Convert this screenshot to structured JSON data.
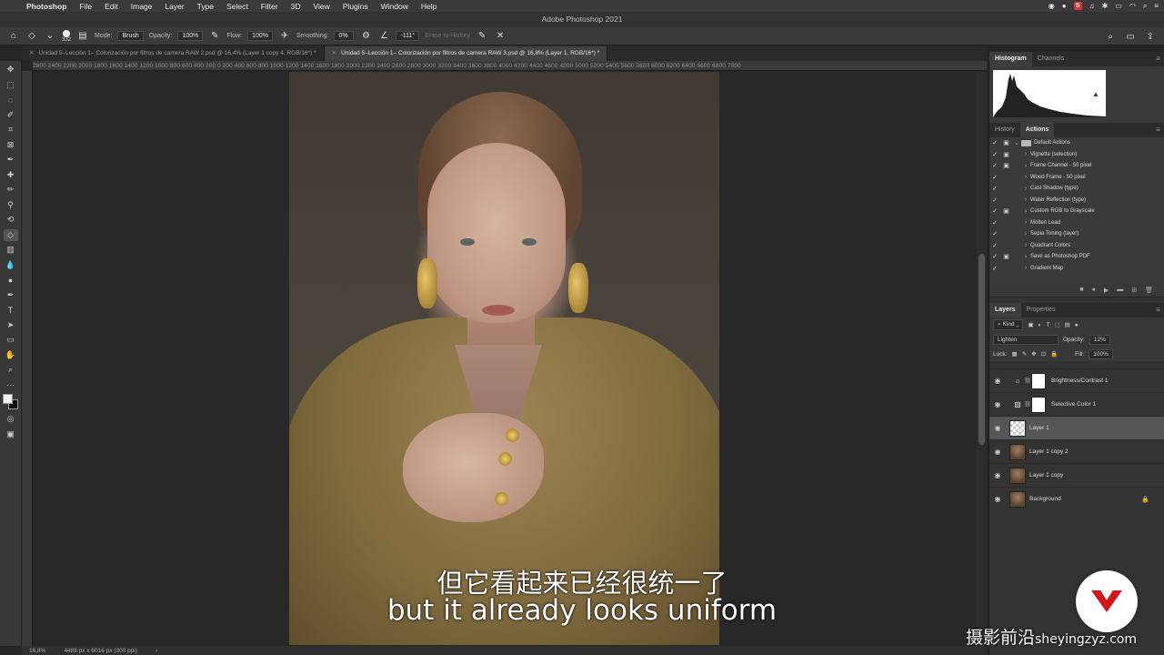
{
  "menubar": {
    "app": "Photoshop",
    "items": [
      "File",
      "Edit",
      "Image",
      "Layer",
      "Type",
      "Select",
      "Filter",
      "3D",
      "View",
      "Plugins",
      "Window",
      "Help"
    ],
    "badge": "S"
  },
  "window": {
    "title": "Adobe Photoshop 2021"
  },
  "options": {
    "brush_size": "332",
    "mode_label": "Mode:",
    "mode_value": "Brush",
    "opacity_label": "Opacity:",
    "opacity_value": "100%",
    "flow_label": "Flow:",
    "flow_value": "100%",
    "smoothing_label": "Smoothing:",
    "smoothing_value": "0%",
    "angle_value": "-111°",
    "erase_history_label": "Erase to History"
  },
  "tabs": [
    "Unidad 5–Lección 1– Colorización por filtros de camera RAW 2.psd @ 16,4% (Layer 1 copy 4, RGB/16*) *",
    "Unidad 5–Lección 1– Colorización por filtros de camera RAW 3.psd @ 16,8% (Layer 1, RGB/16*) *"
  ],
  "ruler": {
    "ticks": "2600 2400 2200 2000 1800 1600 1400 1200 1000 800 600 400 200 0 200 400 600 800 1000 1200 1400 1600 1800 2000 2200 2400 2600 2800 3000 3200 3400 3600 3800 4000 4200 4400 4600 4800 5000 5200 5400 5600 5800 6000 6200 6400 6600 6800 7000"
  },
  "subtitle": {
    "zh": "但它看起来已经很统一了",
    "en": "but it already looks uniform"
  },
  "status": {
    "zoom": "16,8%",
    "doc_size": "4488 px x 6016 px (300 ppi)",
    "arrow": "›"
  },
  "panels": {
    "top_tabs": [
      "Histogram",
      "Channels"
    ],
    "mid_tabs": [
      "History",
      "Actions"
    ],
    "actions": [
      {
        "label": "Default Actions",
        "folder": true,
        "check": "✓",
        "dialog": "▣",
        "expand": "⌄"
      },
      {
        "label": "Vignette (selection)",
        "check": "✓",
        "dialog": "▣",
        "expand": "›"
      },
      {
        "label": "Frame Channel - 50 pixel",
        "check": "✓",
        "dialog": "▣",
        "expand": "›"
      },
      {
        "label": "Wood Frame - 50 pixel",
        "check": "✓",
        "dialog": "",
        "expand": "›"
      },
      {
        "label": "Cast Shadow (type)",
        "check": "✓",
        "dialog": "",
        "expand": "›"
      },
      {
        "label": "Water Reflection (type)",
        "check": "✓",
        "dialog": "",
        "expand": "›"
      },
      {
        "label": "Custom RGB to Grayscale",
        "check": "✓",
        "dialog": "▣",
        "expand": "›"
      },
      {
        "label": "Molten Lead",
        "check": "✓",
        "dialog": "",
        "expand": "›"
      },
      {
        "label": "Sepia Toning (layer)",
        "check": "✓",
        "dialog": "",
        "expand": "›"
      },
      {
        "label": "Quadrant Colors",
        "check": "✓",
        "dialog": "",
        "expand": "›"
      },
      {
        "label": "Save as Photoshop PDF",
        "check": "✓",
        "dialog": "▣",
        "expand": "›"
      },
      {
        "label": "Gradient Map",
        "check": "✓",
        "dialog": "",
        "expand": "›"
      }
    ],
    "layers_tabs": [
      "Layers",
      "Properties"
    ],
    "kind_label": "Kind",
    "blend_mode": "Lighten",
    "opacity_label": "Opacity:",
    "opacity_value": "12%",
    "lock_label": "Lock:",
    "fill_label": "Fill:",
    "fill_value": "100%",
    "layers": [
      {
        "name": "Brightness/Contrast 1",
        "type": "adjustment",
        "adj_icon": "☼",
        "selected": false
      },
      {
        "name": "Selective Color 1",
        "type": "adjustment",
        "adj_icon": "▧",
        "selected": false
      },
      {
        "name": "Layer 1",
        "type": "transparent",
        "selected": true
      },
      {
        "name": "Layer 1 copy 2",
        "type": "photo",
        "selected": false
      },
      {
        "name": "Layer 1 copy",
        "type": "photo",
        "selected": false
      },
      {
        "name": "Background",
        "type": "photo",
        "locked": true,
        "selected": false
      }
    ]
  },
  "watermark": {
    "zh": "摄影前沿",
    "latin": "sheyingzyz.com"
  },
  "colors": {
    "accent": "#d2151c",
    "panel": "#333333",
    "selected_layer": "#555555"
  }
}
